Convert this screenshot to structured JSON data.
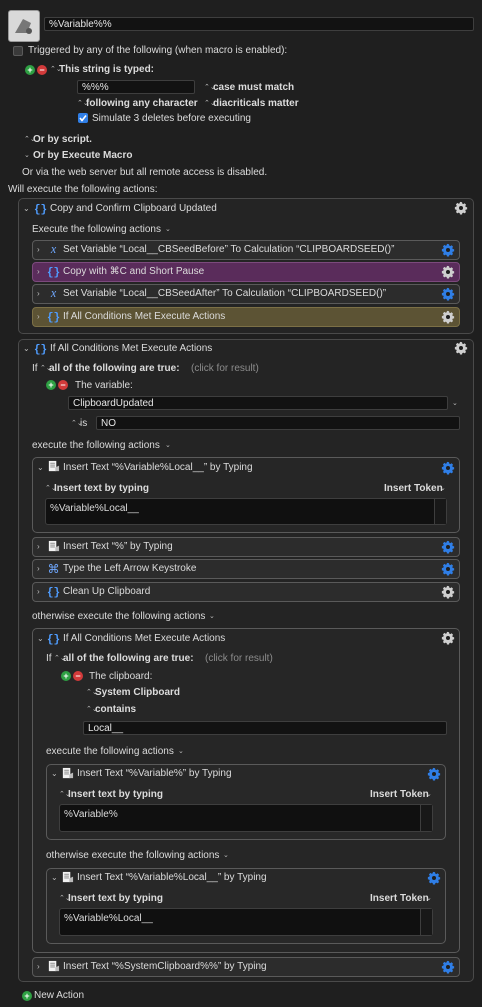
{
  "header": {
    "macro_name": "%Variable%%"
  },
  "triggers": {
    "triggered_label": "Triggered by any of the following (when macro is enabled):",
    "string_typed_label": "This string is typed:",
    "typed_string": "%%%",
    "case_option": "case must match",
    "following_option": "following any character",
    "diacriticals_option": "diacriticals matter",
    "simulate_label": "Simulate 3 deletes before executing",
    "or_by_script": "Or by script.",
    "or_by_execute": "Or by Execute Macro",
    "web_server_note": "Or via the web server but all remote access is disabled."
  },
  "will_execute": "Will execute the following actions:",
  "group1": {
    "title": "Copy and Confirm Clipboard Updated",
    "execute_label": "Execute the following actions",
    "actions": [
      "Set Variable “Local__CBSeedBefore” To Calculation “CLIPBOARDSEED()”",
      "Copy with ⌘C and Short Pause",
      "Set Variable “Local__CBSeedAfter” To Calculation “CLIPBOARDSEED()”",
      "If All Conditions Met Execute Actions"
    ]
  },
  "group2": {
    "title": "If All Conditions Met Execute Actions",
    "if_label": "If",
    "all_true": "all of the following are true:",
    "click_result": "(click for result)",
    "variable_label": "The variable:",
    "variable_value": "ClipboardUpdated",
    "is_label": "is",
    "is_value": "NO",
    "execute_label": "execute the following actions",
    "insert1_title": "Insert Text “%Variable%Local__” by Typing",
    "insert_mode": "Insert text by typing",
    "insert_token": "Insert Token",
    "insert1_text": "%Variable%Local__",
    "insert2_title": "Insert Text “%” by Typing",
    "keystroke_title": "Type the Left Arrow Keystroke",
    "cleanup_title": "Clean Up Clipboard",
    "otherwise_label": "otherwise execute the following actions"
  },
  "group3": {
    "title": "If All Conditions Met Execute Actions",
    "if_label": "If",
    "all_true": "all of the following are true:",
    "click_result": "(click for result)",
    "clipboard_label": "The clipboard:",
    "system_clipboard": "System Clipboard",
    "contains": "contains",
    "contains_value": "Local__",
    "execute_label": "execute the following actions",
    "insert_a_title": "Insert Text “%Variable%” by Typing",
    "insert_mode": "Insert text by typing",
    "insert_token": "Insert Token",
    "insert_a_text": "%Variable%",
    "otherwise_label": "otherwise execute the following actions",
    "insert_b_title": "Insert Text “%Variable%Local__” by Typing",
    "insert_b_text": "%Variable%Local__"
  },
  "final_action": "Insert Text “%SystemClipboard%%” by Typing",
  "new_action": "New Action",
  "colors": {
    "blue_gear": "#2f7ee6",
    "purple": "#5a2c5b",
    "olive": "#5c5334",
    "green": "#2ea043",
    "red": "#d23a3a"
  }
}
